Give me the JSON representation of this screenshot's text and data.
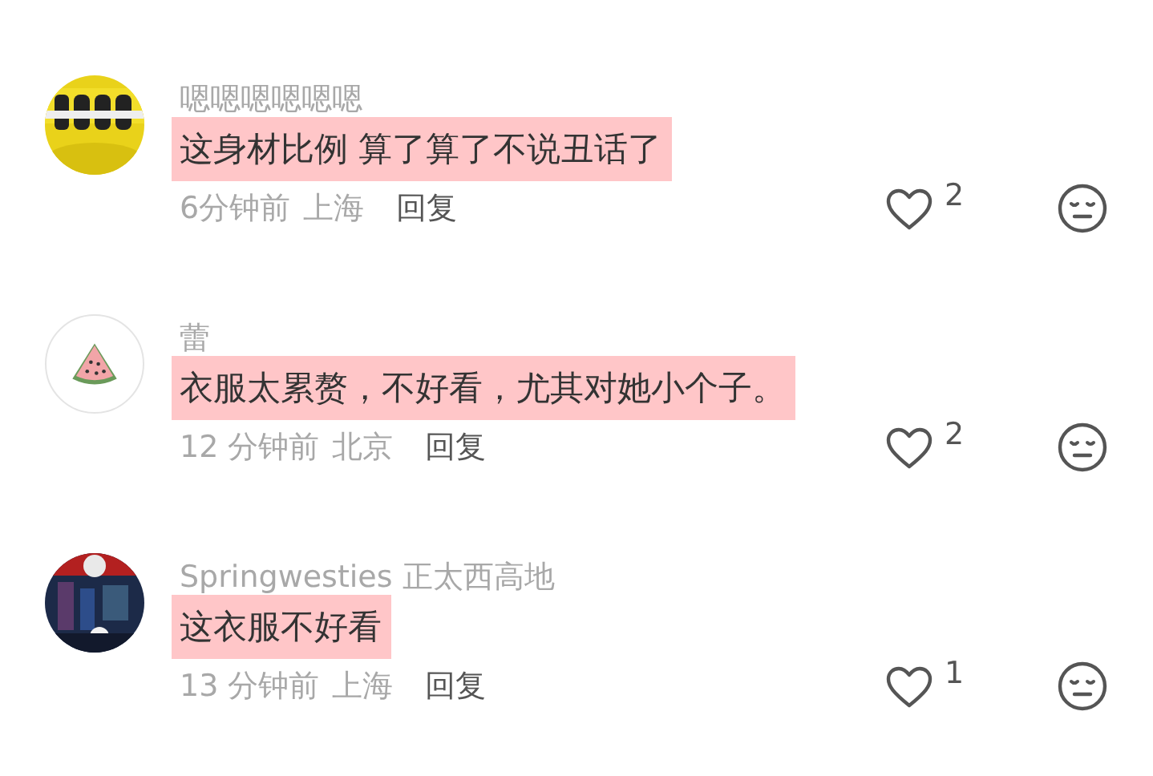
{
  "comments": [
    {
      "user": "嗯嗯嗯嗯嗯嗯",
      "text": "这身材比例 算了算了不说丑话了",
      "highlighted": true,
      "time": "6分钟前",
      "location": "上海",
      "reply": "回复",
      "likes": "2",
      "liked": false
    },
    {
      "avatar": {
        "kind": "watermelon"
      },
      "user": "蕾",
      "text": "衣服太累赘，不好看，尤其对她小个子。",
      "highlighted": true,
      "time": "12 分钟前",
      "location": "北京",
      "reply": "回复",
      "likes": "2",
      "liked": false
    },
    {
      "user": "Springwesties 正太西高地",
      "text": "这衣服不好看",
      "highlighted": true,
      "time": "13 分钟前",
      "location": "上海",
      "reply": "回复",
      "likes": "1",
      "liked": false
    }
  ]
}
